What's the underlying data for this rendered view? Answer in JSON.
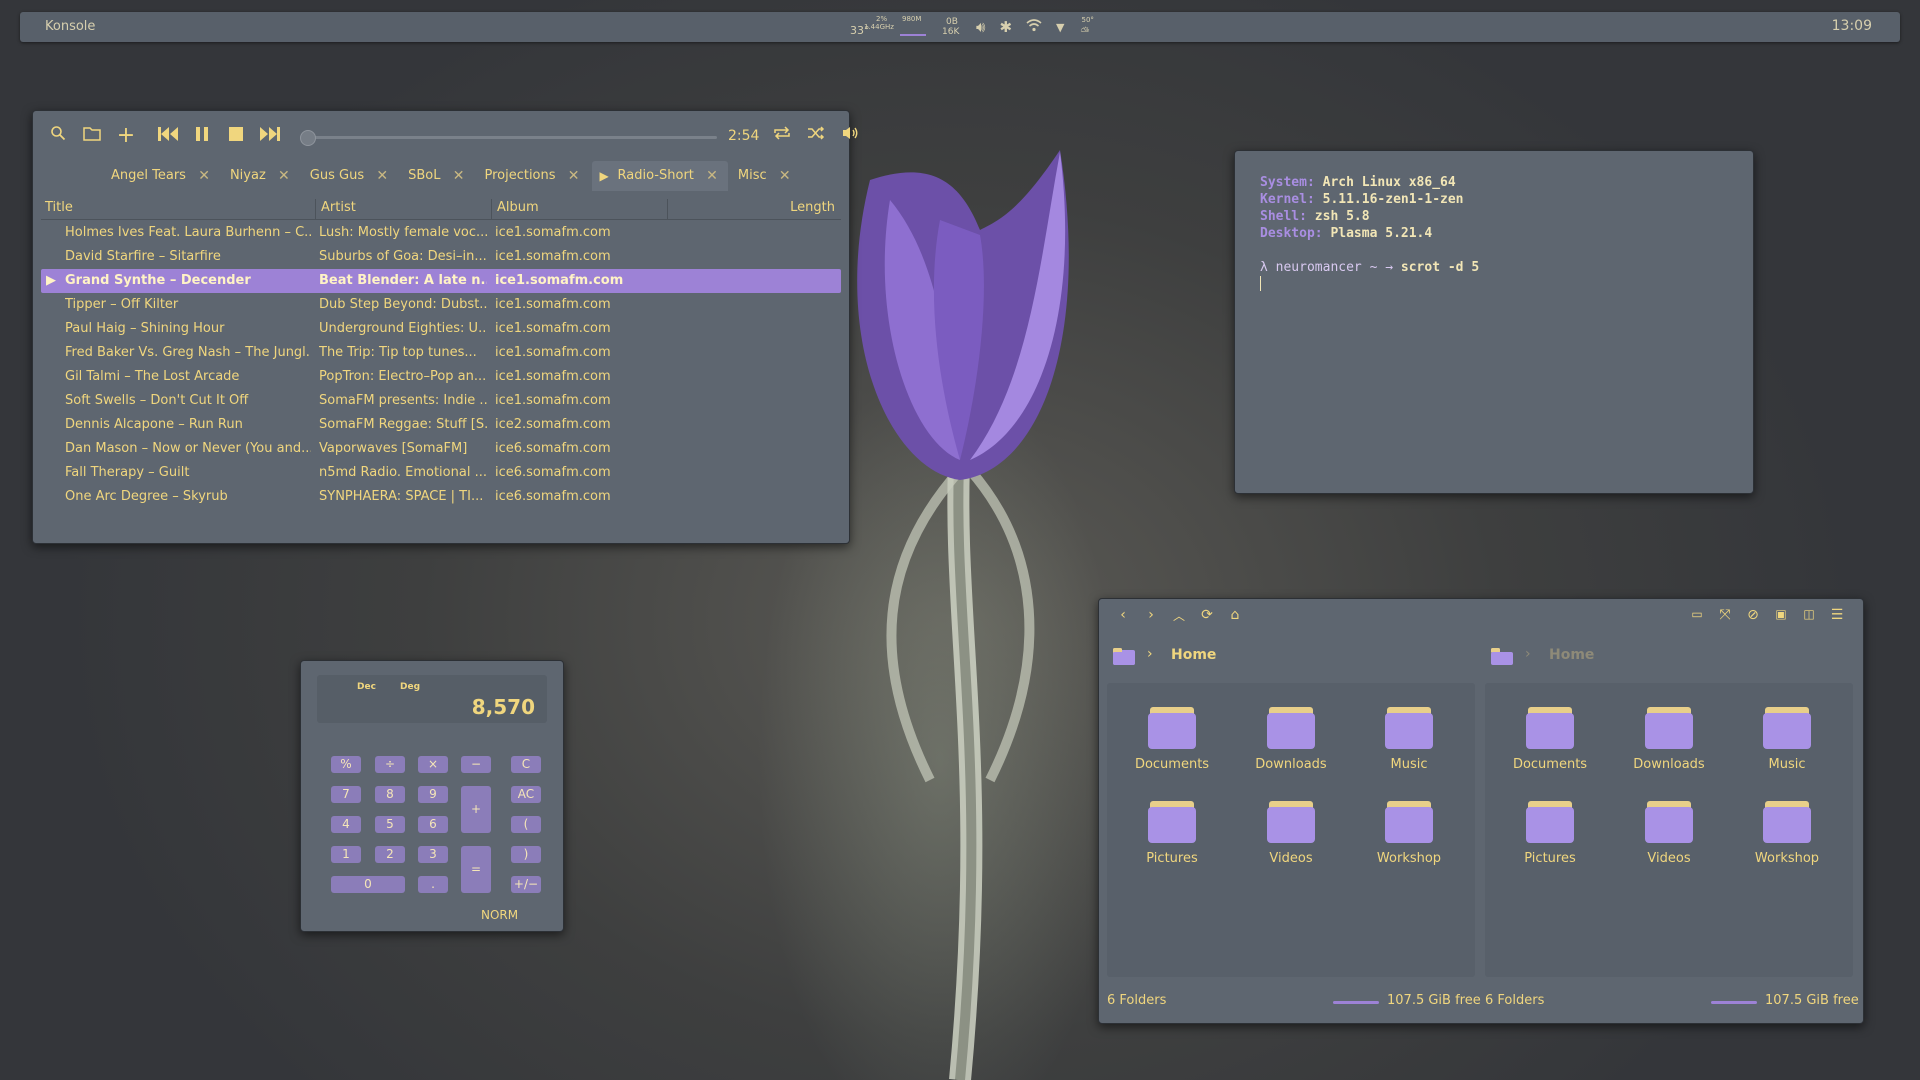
{
  "panel": {
    "title": "Konsole",
    "temp": "33°",
    "cpu_pct": "2%",
    "cpu_freq": "1.44GHz",
    "mem": "980M",
    "net_up": "0B",
    "net_down": "16K",
    "weather": "50°",
    "clock": "13:09"
  },
  "player": {
    "time": "2:54",
    "progress": 0.0,
    "tabs": [
      {
        "label": "Angel Tears",
        "active": false
      },
      {
        "label": "Niyaz",
        "active": false
      },
      {
        "label": "Gus Gus",
        "active": false
      },
      {
        "label": "SBoL",
        "active": false
      },
      {
        "label": "Projections",
        "active": false
      },
      {
        "label": "Radio-Short",
        "active": true
      },
      {
        "label": "Misc",
        "active": false
      }
    ],
    "columns": {
      "title": "Title",
      "artist": "Artist",
      "album": "Album",
      "length": "Length"
    },
    "rows": [
      {
        "title": "Holmes Ives Feat. Laura Burhenn – C...",
        "artist": "Lush: Mostly female voc...",
        "album": "ice1.somafm.com",
        "selected": false
      },
      {
        "title": "David Starfire – Sitarfire",
        "artist": "Suburbs of Goa: Desi–in...",
        "album": "ice1.somafm.com",
        "selected": false
      },
      {
        "title": "Grand Synthe – Decender",
        "artist": "Beat Blender: A late n...",
        "album": "ice1.somafm.com",
        "selected": true
      },
      {
        "title": "Tipper – Off Kilter",
        "artist": "Dub Step Beyond: Dubst...",
        "album": "ice1.somafm.com",
        "selected": false
      },
      {
        "title": "Paul Haig – Shining Hour",
        "artist": "Underground Eighties: U...",
        "album": "ice1.somafm.com",
        "selected": false
      },
      {
        "title": "Fred Baker Vs. Greg Nash – The Jungl...",
        "artist": "The Trip:  Tip top tunes...",
        "album": "ice1.somafm.com",
        "selected": false
      },
      {
        "title": "Gil Talmi – The Lost Arcade",
        "artist": "PopTron: Electro–Pop an...",
        "album": "ice1.somafm.com",
        "selected": false
      },
      {
        "title": "Soft Swells – Don't Cut It Off",
        "artist": "SomaFM presents: Indie ...",
        "album": "ice1.somafm.com",
        "selected": false
      },
      {
        "title": "Dennis Alcapone – Run Run",
        "artist": "SomaFM Reggae: Stuff [S...",
        "album": "ice2.somafm.com",
        "selected": false
      },
      {
        "title": "Dan Mason – Now or Never (You and...",
        "artist": "Vaporwaves [SomaFM]",
        "album": "ice6.somafm.com",
        "selected": false
      },
      {
        "title": "Fall Therapy – Guilt",
        "artist": "n5md Radio. Emotional ...",
        "album": "ice6.somafm.com",
        "selected": false
      },
      {
        "title": "One Arc Degree – Skyrub",
        "artist": "SYNPHAERA: SPACE | TI...",
        "album": "ice6.somafm.com",
        "selected": false
      }
    ]
  },
  "terminal": {
    "system_label": "System:",
    "system": "Arch Linux x86_64",
    "kernel_label": "Kernel:",
    "kernel": "5.11.16-zen1-1-zen",
    "shell_label": "Shell:",
    "shell": "zsh 5.8",
    "desktop_label": "Desktop:",
    "desktop": "Plasma 5.21.4",
    "prompt": "λ neuromancer ~ →",
    "command": "scrot -d 5"
  },
  "calculator": {
    "base": "Dec",
    "angle": "Deg",
    "display": "8,570",
    "mode": "NORM",
    "keys": [
      "%",
      "÷",
      "×",
      "−",
      "C",
      "7",
      "8",
      "9",
      "+",
      "AC",
      "4",
      "5",
      "6",
      "(",
      "1",
      "2",
      "3",
      "=",
      ")",
      "0",
      ".",
      "+/−"
    ]
  },
  "filemanager": {
    "left": {
      "path": "Home",
      "folders": [
        "Documents",
        "Downloads",
        "Music",
        "Pictures",
        "Videos",
        "Workshop"
      ],
      "status": "6 Folders",
      "free": "107.5 GiB free"
    },
    "right": {
      "path": "Home",
      "folders": [
        "Documents",
        "Downloads",
        "Music",
        "Pictures",
        "Videos",
        "Workshop"
      ],
      "status": "6 Folders",
      "free": "107.5 GiB free"
    }
  },
  "colors": {
    "accent": "#9d82d6",
    "text": "#f0d67e",
    "window": "#5e6670",
    "folder": "#a992e6",
    "folder_tab": "#e8cf8a"
  }
}
